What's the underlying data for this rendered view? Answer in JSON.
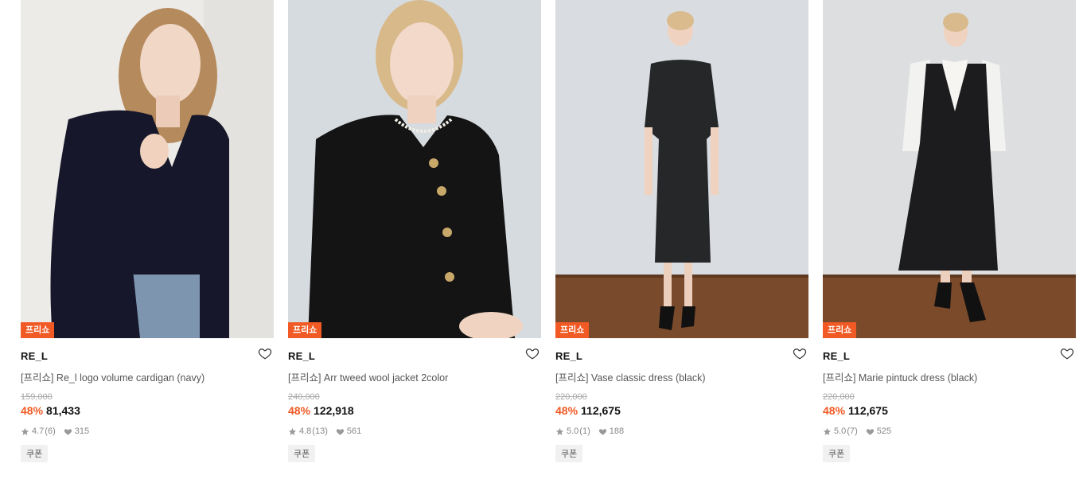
{
  "products": [
    {
      "badge": "프리쇼",
      "brand": "RE_L",
      "title": "[프리쇼] Re_l logo volume cardigan (navy)",
      "original_price": "159,000",
      "discount": "48%",
      "price": "81,433",
      "rating": "4.7",
      "reviews": "(6)",
      "likes": "315",
      "coupon": "쿠폰",
      "image": "woman-navy-cardigan-photo"
    },
    {
      "badge": "프리쇼",
      "brand": "RE_L",
      "title": "[프리쇼] Arr tweed wool jacket 2color",
      "original_price": "240,000",
      "discount": "48%",
      "price": "122,918",
      "rating": "4.8",
      "reviews": "(13)",
      "likes": "561",
      "coupon": "쿠폰",
      "image": "woman-black-tweed-jacket-photo"
    },
    {
      "badge": "프리쇼",
      "brand": "RE_L",
      "title": "[프리쇼] Vase classic dress (black)",
      "original_price": "220,000",
      "discount": "48%",
      "price": "112,675",
      "rating": "5.0",
      "reviews": "(1)",
      "likes": "188",
      "coupon": "쿠폰",
      "image": "woman-black-dress-photo"
    },
    {
      "badge": "프리쇼",
      "brand": "RE_L",
      "title": "[프리쇼] Marie pintuck dress (black)",
      "original_price": "220,000",
      "discount": "48%",
      "price": "112,675",
      "rating": "5.0",
      "reviews": "(7)",
      "likes": "525",
      "coupon": "쿠폰",
      "image": "woman-pintuck-dress-photo"
    }
  ],
  "colors": {
    "accent": "#f15a24",
    "text": "#111111",
    "muted": "#888888"
  },
  "icons": {
    "wishlist": "heart-outline-icon",
    "rating": "star-icon",
    "likes": "heart-filled-icon"
  }
}
